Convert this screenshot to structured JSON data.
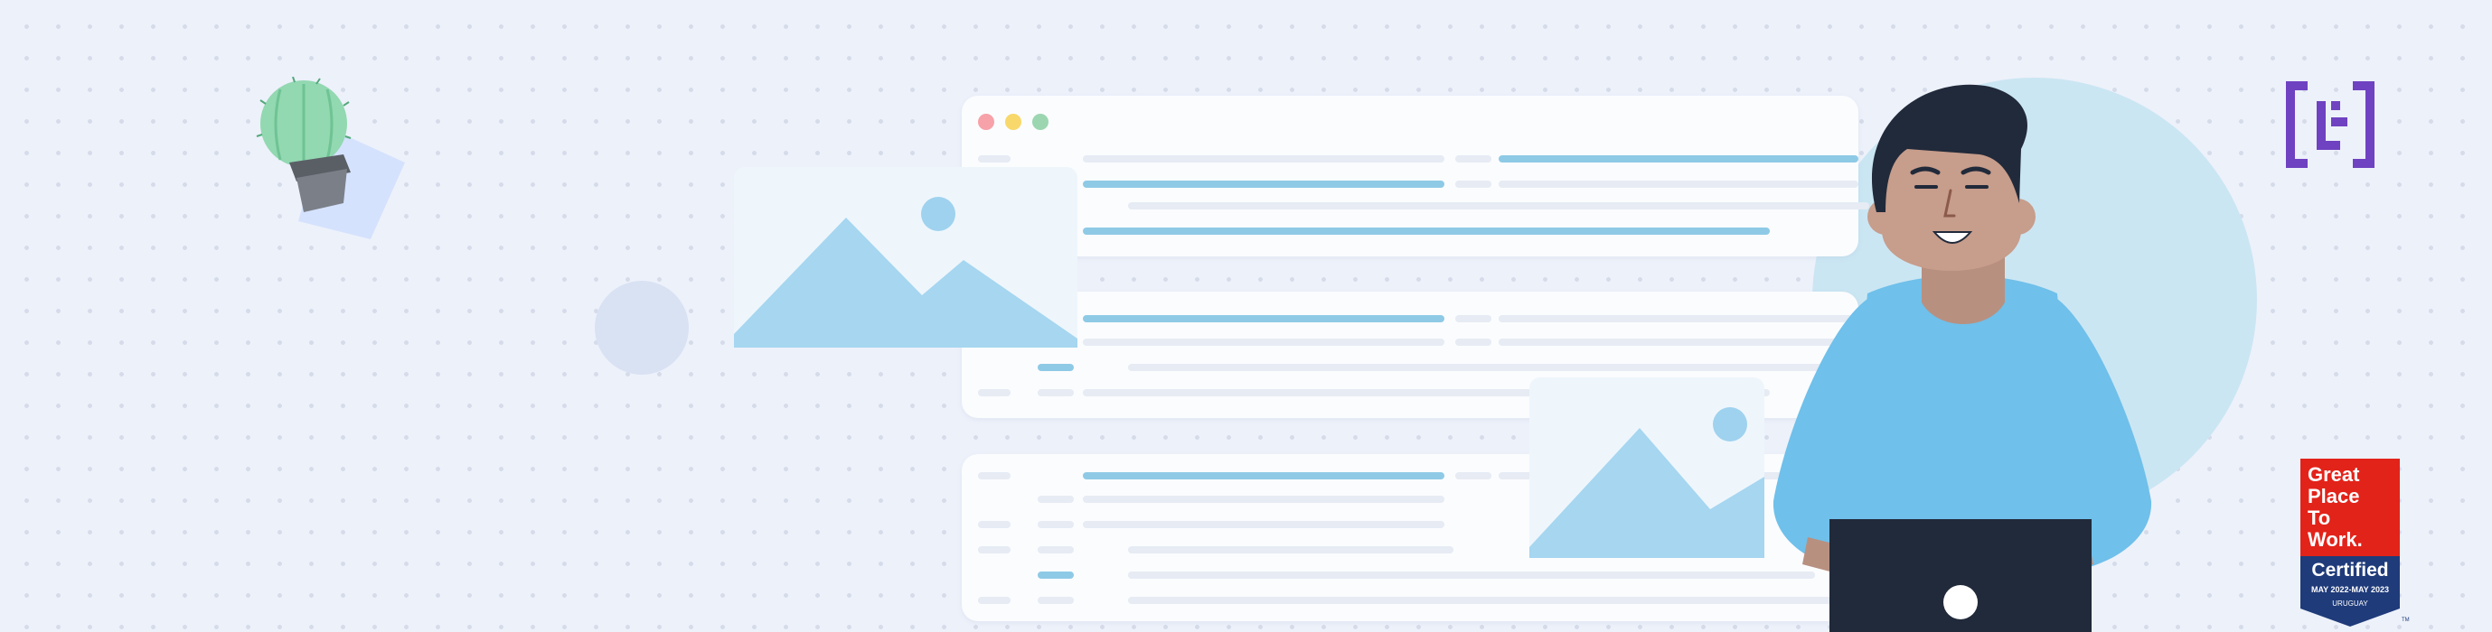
{
  "scene": {
    "description_free": true,
    "background_color": "#edf1fa",
    "accent_blue": "#8ecae6",
    "window_dots": [
      "#f7a1a8",
      "#f8d86b",
      "#9bd6b0"
    ]
  },
  "logo": {
    "icon": "bracket-logo-icon",
    "color": "#6f42c1"
  },
  "badge": {
    "line1": "Great",
    "line2": "Place",
    "line3": "To",
    "line4": "Work.",
    "certified": "Certified",
    "dates": "MAY 2022-MAY 2023",
    "country": "URUGUAY",
    "trademark": "TM",
    "top_color": "#e2231a",
    "bottom_color": "#1f3b7a"
  },
  "illustration": {
    "plant_icon": "cactus-pot-icon",
    "person_icon": "person-with-laptop-icon",
    "image_placeholder_icon": "image-placeholder-icon"
  }
}
